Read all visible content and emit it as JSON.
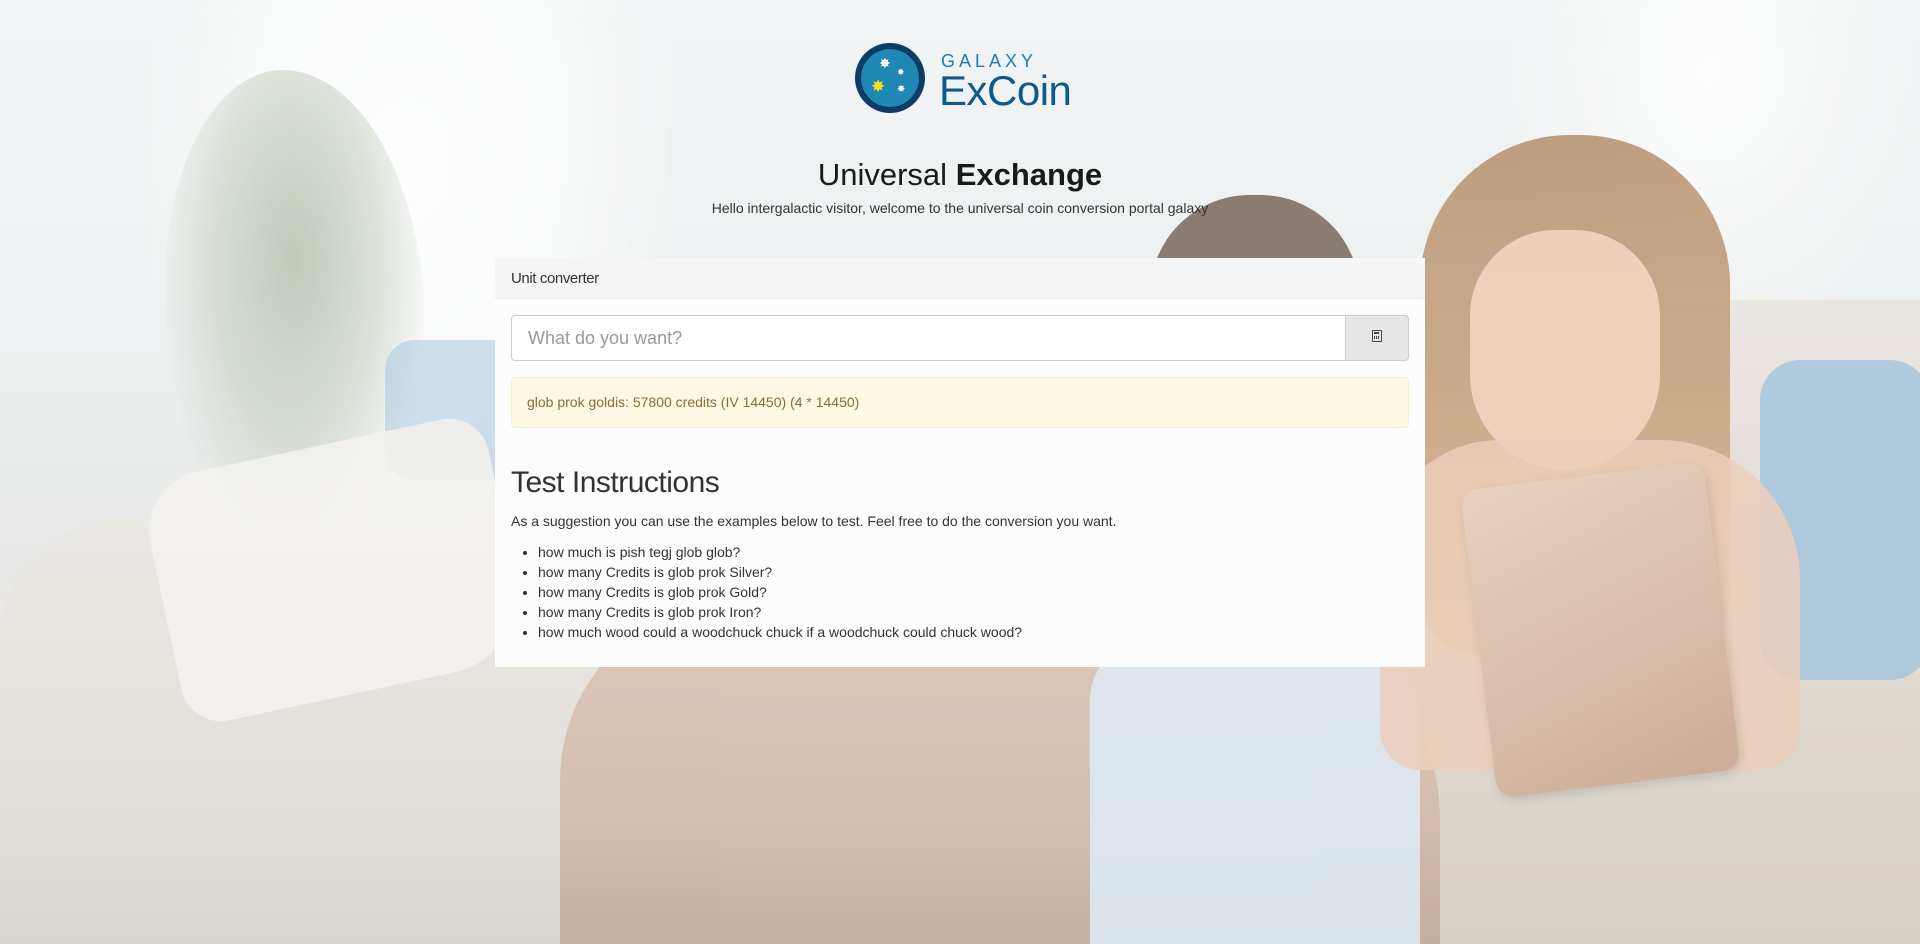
{
  "brand": {
    "top": "GALAXY",
    "main": "ExCoin"
  },
  "hero": {
    "title_light": "Universal",
    "title_bold": "Exchange",
    "subtitle": "Hello intergalactic visitor, welcome to the universal coin conversion portal galaxy"
  },
  "converter": {
    "heading": "Unit converter",
    "input_placeholder": "What do you want?",
    "button_icon": "calculator-icon",
    "result": "glob prok goldis: 57800 credits (IV 14450) (4 * 14450)"
  },
  "instructions": {
    "title": "Test Instructions",
    "text": "As a suggestion you can use the examples below to test. Feel free to do the conversion you want.",
    "examples": [
      "how much is pish tegj glob glob?",
      "how many Credits is glob prok Silver?",
      "how many Credits is glob prok Gold?",
      "how many Credits is glob prok Iron?",
      "how much wood could a woodchuck chuck if a woodchuck could chuck wood?"
    ]
  },
  "colors": {
    "brand_blue": "#0d5b8e",
    "alert_bg": "#fcf8e3",
    "alert_text": "#8a6d3b"
  }
}
